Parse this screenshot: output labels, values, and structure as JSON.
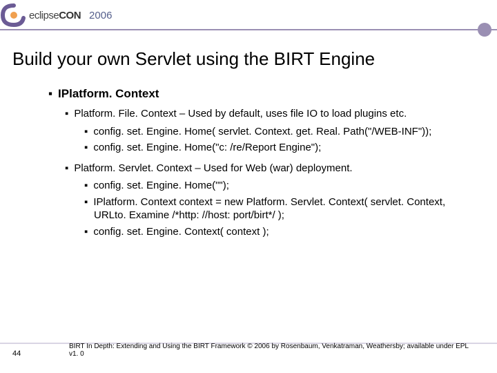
{
  "header": {
    "logo_prefix": "eclipse",
    "logo_suffix": "CON",
    "year": "2006"
  },
  "title": "Build your own Servlet using the BIRT Engine",
  "content": {
    "heading": "IPlatform. Context",
    "sections": [
      {
        "intro": "Platform. File. Context – Used by default, uses file IO to load plugins etc.",
        "items": [
          "config. set. Engine. Home( servlet. Context. get. Real. Path(\"/WEB-INF\"));",
          "config. set. Engine. Home(\"c: /re/Report Engine\");"
        ]
      },
      {
        "intro": "Platform. Servlet. Context – Used for Web (war) deployment.",
        "items": [
          "config. set. Engine. Home(\"\");",
          "IPlatform. Context context = new Platform. Servlet. Context( servlet. Context, URLto. Examine /*http: //host: port/birt*/ );",
          "config. set. Engine. Context( context );"
        ]
      }
    ]
  },
  "page_number": "44",
  "footer": "BIRT In Depth: Extending and Using the BIRT Framework © 2006 by Rosenbaum, Venkatraman, Weathersby; available under EPL v1. 0"
}
